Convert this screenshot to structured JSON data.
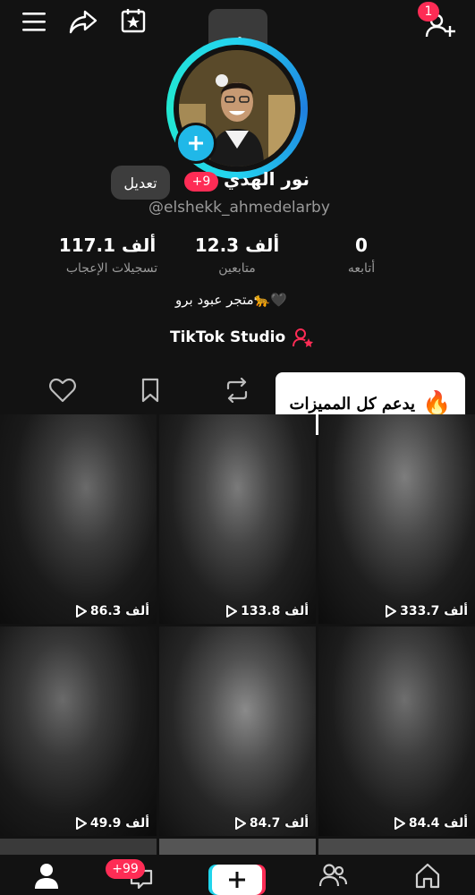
{
  "header": {
    "menu_icon": "hamburger-icon",
    "share_icon": "share-arrow-icon",
    "calendar_icon": "calendar-star-icon",
    "add_friend_icon": "add-user-icon",
    "notification_count": "1"
  },
  "profile": {
    "edit_label": "تعديل",
    "name_badge": "+9",
    "display_name": "نور الهدي",
    "username": "@elshekk_ahmedelarby",
    "bio": "متجر عبود برو🐆🖤",
    "studio_label": "TikTok Studio"
  },
  "stats": [
    {
      "value": "117.1 ألف",
      "label": "تسجيلات الإعجاب"
    },
    {
      "value": "12.3 ألف",
      "label": "متابعين"
    },
    {
      "value": "0",
      "label": "أتابعه"
    }
  ],
  "tabs": [
    "liked-icon",
    "saved-icon",
    "reposts-icon"
  ],
  "promo": {
    "text": "يدعم كل المميزات",
    "emoji": "🔥"
  },
  "videos": [
    {
      "views": "86.3 ألف"
    },
    {
      "views": "133.8 ألف"
    },
    {
      "views": "333.7 ألف"
    },
    {
      "views": "49.9 ألف"
    },
    {
      "views": "84.7 ألف"
    },
    {
      "views": "84.4 ألف"
    }
  ],
  "bottom_nav": {
    "inbox_badge": "+99",
    "items": [
      "profile-icon",
      "inbox-icon",
      "create-icon",
      "friends-icon",
      "home-icon"
    ]
  },
  "colors": {
    "accent": "#fe2c55",
    "ring": "#23d3f0",
    "background": "#121212"
  }
}
